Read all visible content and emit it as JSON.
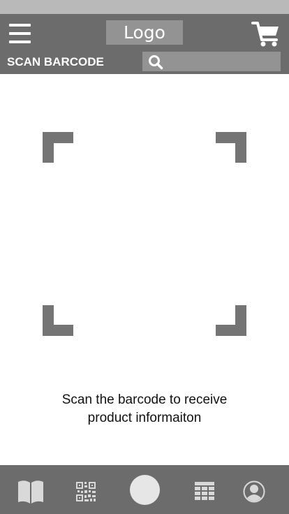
{
  "header": {
    "logo_text": "Logo",
    "title": "SCAN BARCODE",
    "menu_icon": "hamburger-menu-icon",
    "cart_icon": "shopping-cart-icon",
    "search_icon": "search-icon"
  },
  "scanner": {
    "instruction_line1": "Scan the barcode to receive",
    "instruction_line2": "product informaiton"
  },
  "bottom_nav": {
    "items": [
      {
        "icon": "book-icon"
      },
      {
        "icon": "qr-code-icon"
      },
      {
        "icon": "camera-shutter-button"
      },
      {
        "icon": "grid-table-icon"
      },
      {
        "icon": "user-profile-icon"
      }
    ]
  },
  "colors": {
    "header_bg": "#6c6c6c",
    "status_bar": "#b9b9b9",
    "placeholder_fill": "#939393",
    "corner_marks": "#747474",
    "icon_light": "#d9d9d9"
  }
}
